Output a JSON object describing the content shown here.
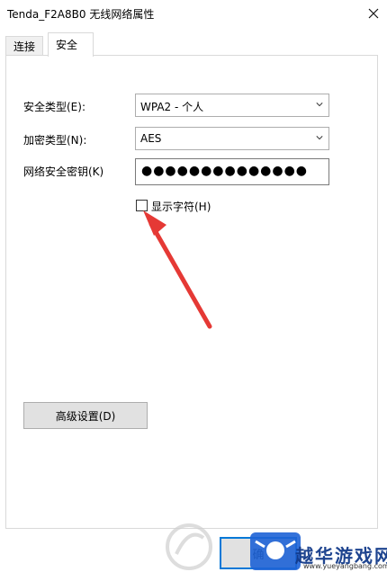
{
  "window": {
    "title": "Tenda_F2A8B0 无线网络属性",
    "close_icon": "close-icon"
  },
  "tabs": [
    {
      "label": "连接"
    },
    {
      "label": "安全"
    }
  ],
  "security": {
    "type_label": "安全类型(E):",
    "type_value": "WPA2 - 个人",
    "encryption_label": "加密类型(N):",
    "encryption_value": "AES",
    "key_label": "网络安全密钥(K)",
    "key_masked": "●●●●●●●●●●●●●●",
    "show_chars_label": "显示字符(H)",
    "show_chars_checked": false,
    "advanced_button": "高级设置(D)"
  },
  "footer": {
    "partial_button": "确"
  },
  "watermark": {
    "brand": "越华游戏网",
    "url": "www.yueyangbang.com"
  },
  "colors": {
    "arrow": "#e53935",
    "accent": "#0078d7"
  }
}
